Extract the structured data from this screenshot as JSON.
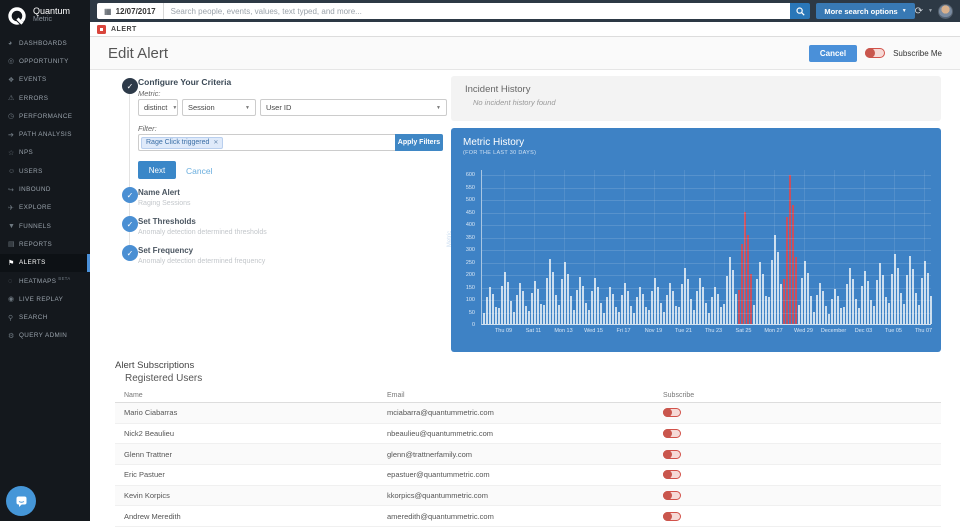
{
  "topbar": {
    "date": "12/07/2017",
    "search_placeholder": "Search people, events, values, text typed, and more...",
    "more_search": "More search options",
    "refresh_icon": "⟳"
  },
  "sidebar": {
    "logo_line1": "Quantum",
    "logo_line2": "Metric",
    "items": [
      {
        "label": "DASHBOARDS",
        "icon": "dashboards-icon",
        "glyph": "◕",
        "active": false
      },
      {
        "label": "OPPORTUNITY",
        "icon": "opportunity-icon",
        "glyph": "◎",
        "active": false
      },
      {
        "label": "EVENTS",
        "icon": "events-icon",
        "glyph": "❖",
        "active": false
      },
      {
        "label": "ERRORS",
        "icon": "errors-icon",
        "glyph": "⚠",
        "active": false
      },
      {
        "label": "PERFORMANCE",
        "icon": "performance-icon",
        "glyph": "◷",
        "active": false
      },
      {
        "label": "PATH ANALYSIS",
        "icon": "path-analysis-icon",
        "glyph": "➔",
        "active": false
      },
      {
        "label": "NPS",
        "icon": "nps-icon",
        "glyph": "☆",
        "active": false
      },
      {
        "label": "USERS",
        "icon": "users-icon",
        "glyph": "☺",
        "active": false
      },
      {
        "label": "INBOUND",
        "icon": "inbound-icon",
        "glyph": "↪",
        "active": false
      },
      {
        "label": "EXPLORE",
        "icon": "explore-icon",
        "glyph": "✈",
        "active": false
      },
      {
        "label": "FUNNELS",
        "icon": "funnels-icon",
        "glyph": "▼",
        "active": false
      },
      {
        "label": "REPORTS",
        "icon": "reports-icon",
        "glyph": "▤",
        "active": false
      },
      {
        "label": "ALERTS",
        "icon": "alerts-flag-icon",
        "glyph": "⚑",
        "active": true
      },
      {
        "label": "HEATMAPS",
        "icon": "heatmaps-icon",
        "glyph": "◌",
        "active": false,
        "badge": "BETA"
      },
      {
        "label": "LIVE REPLAY",
        "icon": "live-replay-icon",
        "glyph": "◉",
        "active": false
      },
      {
        "label": "SEARCH",
        "icon": "search-nav-icon",
        "glyph": "⚲",
        "active": false
      },
      {
        "label": "QUERY ADMIN",
        "icon": "query-admin-icon",
        "glyph": "⚙",
        "active": false
      }
    ]
  },
  "tabbar": {
    "tab": "ALERT"
  },
  "header": {
    "title": "Edit Alert",
    "cancel": "Cancel",
    "subscribe": "Subscribe Me"
  },
  "steps": {
    "step1": {
      "title": "Configure Your Criteria",
      "metric_label": "Metric:",
      "dd1": "distinct",
      "dd2": "Session",
      "dd3": "User ID",
      "filter_label": "Filter:",
      "chip": "Rage Click triggered",
      "chip_close": "✕",
      "apply": "Apply Filters",
      "next": "Next",
      "cancel": "Cancel",
      "check": "✓"
    },
    "others": [
      {
        "title": "Name Alert",
        "subtitle": "Raging Sessions"
      },
      {
        "title": "Set Thresholds",
        "subtitle": "Anomaly detection determined thresholds"
      },
      {
        "title": "Set Frequency",
        "subtitle": "Anomaly detection determined frequency"
      }
    ]
  },
  "incident": {
    "title": "Incident History",
    "empty": "No incident history found"
  },
  "chart_data": {
    "type": "bar",
    "title": "Metric History",
    "subtitle": "(FOR THE LAST 30 DAYS)",
    "ylabel": "Metric",
    "ylim": [
      0,
      600
    ],
    "ymax_headroom": 620,
    "ytick_step": 50,
    "grid": true,
    "bar_color": "#ccdeee",
    "red_color": "#c75060",
    "panel_color": "#3e82c5",
    "x_ticks": [
      {
        "label": "Thu 09",
        "day": 1
      },
      {
        "label": "Sat 11",
        "day": 3
      },
      {
        "label": "Mon 13",
        "day": 5
      },
      {
        "label": "Wed 15",
        "day": 7
      },
      {
        "label": "Fri 17",
        "day": 9
      },
      {
        "label": "Nov 19",
        "day": 11
      },
      {
        "label": "Tue 21",
        "day": 13
      },
      {
        "label": "Thu 23",
        "day": 15
      },
      {
        "label": "Sat 25",
        "day": 17
      },
      {
        "label": "Mon 27",
        "day": 19
      },
      {
        "label": "Wed 29",
        "day": 21
      },
      {
        "label": "December",
        "day": 23
      },
      {
        "label": "Dec 03",
        "day": 25
      },
      {
        "label": "Tue 05",
        "day": 27
      },
      {
        "label": "Thu 07",
        "day": 29
      }
    ],
    "daily_peaks": [
      150,
      210,
      165,
      175,
      260,
      250,
      190,
      185,
      150,
      165,
      150,
      185,
      165,
      225,
      185,
      150,
      270,
      450,
      250,
      360,
      600,
      255,
      165,
      140,
      225,
      215,
      245,
      280,
      275,
      255
    ],
    "red_days": [
      17,
      20
    ],
    "day_fractions": [
      0.3,
      0.72,
      1.0,
      0.8,
      0.45
    ]
  },
  "subscriptions": {
    "title": "Alert Subscriptions",
    "subtitle": "Registered Users",
    "columns": [
      "Name",
      "Email",
      "Subscribe"
    ],
    "rows": [
      {
        "name": "Mario Ciabarras",
        "email": "mciabarra@quantummetric.com"
      },
      {
        "name": "Nick2 Beaulieu",
        "email": "nbeaulieu@quantummetric.com"
      },
      {
        "name": "Glenn Trattner",
        "email": "glenn@trattnerfamily.com"
      },
      {
        "name": "Eric Pastuer",
        "email": "epastuer@quantummetric.com"
      },
      {
        "name": "Kevin Korpics",
        "email": "kkorpics@quantummetric.com"
      },
      {
        "name": "Andrew Meredith",
        "email": "ameredith@quantummetric.com"
      }
    ]
  }
}
